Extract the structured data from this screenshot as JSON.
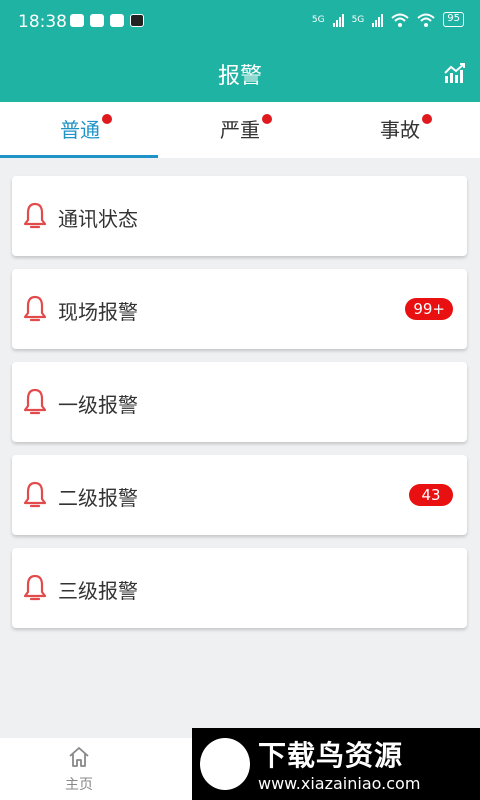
{
  "status_bar": {
    "time": "18:38",
    "network_1": "5G",
    "network_2": "5G",
    "battery": "95"
  },
  "app_bar": {
    "title": "报警"
  },
  "tabs": [
    {
      "label": "普通",
      "active": true,
      "has_dot": true
    },
    {
      "label": "严重",
      "active": false,
      "has_dot": true
    },
    {
      "label": "事故",
      "active": false,
      "has_dot": true
    }
  ],
  "alarm_items": [
    {
      "label": "通讯状态",
      "badge": ""
    },
    {
      "label": "现场报警",
      "badge": "99+"
    },
    {
      "label": "一级报警",
      "badge": ""
    },
    {
      "label": "二级报警",
      "badge": "43"
    },
    {
      "label": "三级报警",
      "badge": ""
    }
  ],
  "bottom_nav": {
    "home_label": "主页"
  },
  "watermark": {
    "title": "下载鸟资源",
    "url": "www.xiazainiao.com"
  },
  "colors": {
    "primary": "#1fb3a3",
    "tab_active": "#1e93c8",
    "badge": "#e81010",
    "bell": "#e14b4b"
  },
  "icons": [
    "wechat-icon",
    "chat-icon",
    "mail-icon",
    "signal-icon",
    "wifi-icon",
    "battery-icon",
    "chart-icon",
    "bell-icon",
    "home-icon"
  ]
}
